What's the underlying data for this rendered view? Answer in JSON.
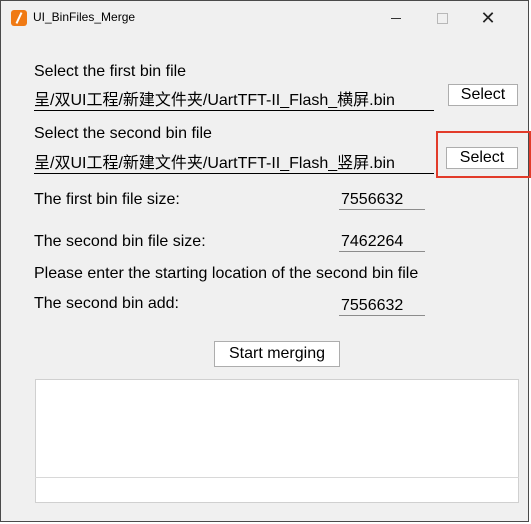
{
  "window": {
    "title": "UI_BinFiles_Merge",
    "icon": "app-logo-icon",
    "controls": {
      "minimize_icon": "minimize-icon",
      "maximize_icon": "maximize-icon",
      "close_icon": "close-icon",
      "close_glyph": "✕"
    }
  },
  "first_bin": {
    "label": "Select the first bin file",
    "path": "呈/双UI工程/新建文件夹/UartTFT-II_Flash_横屏.bin",
    "button_label": "Select"
  },
  "second_bin": {
    "label": "Select the second bin file",
    "path": "呈/双UI工程/新建文件夹/UartTFT-II_Flash_竖屏.bin",
    "button_label": "Select"
  },
  "sizes": {
    "first_label": "The first bin file size:",
    "first_value": "7556632",
    "second_label": "The second bin file size:",
    "second_value": "7462264"
  },
  "start_location": {
    "prompt": "Please enter the starting location of the second bin file",
    "add_label": "The second bin add:",
    "add_value": "7556632"
  },
  "actions": {
    "start_label": "Start merging"
  },
  "output": {
    "text": ""
  },
  "colors": {
    "highlight": "#e23b2a",
    "window_bg": "#f0f0f0",
    "app_icon": "#f07a14"
  }
}
